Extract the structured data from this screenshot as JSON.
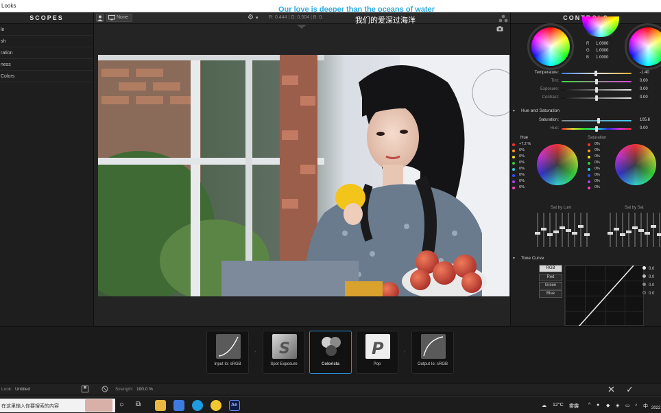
{
  "window": {
    "title": "Looks"
  },
  "subtitles": {
    "english": "Our love is deeper than the oceans of water",
    "chinese": "我们的爱深过海洋"
  },
  "scopes": {
    "header": "SCOPES",
    "items": [
      "le",
      "sh",
      "ration",
      "ness",
      "Colors"
    ]
  },
  "viewer": {
    "preset_label": "None",
    "readout": "R: 0.444 | G: 0.504 | B: 0.",
    "gear_menu": "▾"
  },
  "controls": {
    "header": "CONTROLS",
    "rgb_values": {
      "r_label": "R",
      "g_label": "G",
      "b_label": "B",
      "r": "1.0000",
      "g": "1.0000",
      "b": "1.0000"
    },
    "color_sliders": [
      {
        "label": "Temperature:",
        "value": "-1.40",
        "pos": 0.49
      },
      {
        "label": "Tint:",
        "value": "0.00",
        "pos": 0.5
      },
      {
        "label": "Exposure:",
        "value": "0.00",
        "pos": 0.5
      },
      {
        "label": "Contrast:",
        "value": "0.00",
        "pos": 0.5
      }
    ],
    "hue_sat": {
      "title": "Hue and Saturation",
      "sliders": [
        {
          "label": "Saturation:",
          "value": "105.6",
          "pos": 0.53
        },
        {
          "label": "Hue:",
          "value": "0.00",
          "pos": 0.5
        }
      ],
      "hue_label": "Hue",
      "sat_label": "Saturation",
      "hue_values": [
        "+7.2 %",
        "0%",
        "0%",
        "0%",
        "0%",
        "0%",
        "0%",
        "0%"
      ],
      "sat_values": [
        "0%",
        "0%",
        "0%",
        "0%",
        "0%",
        "0%",
        "0%",
        "0%"
      ],
      "dot_colors": [
        "#ff3030",
        "#ff9a20",
        "#f0e020",
        "#30d030",
        "#30d0d0",
        "#3050ff",
        "#b040f0",
        "#ff40c0"
      ]
    },
    "sat_by_lum": "Sat by Lum",
    "sat_by_sat": "Sat by Sat",
    "tone_curve": {
      "title": "Tone Curve",
      "channels": [
        "RGB",
        "Red",
        "Green",
        "Blue"
      ],
      "active": "RGB",
      "point_values": [
        "0.0",
        "0.0",
        "0.0",
        "0.0"
      ]
    }
  },
  "tools": [
    {
      "name": "Input Io: sRGB",
      "active": false
    },
    {
      "name": "Spot Exposure",
      "active": false
    },
    {
      "name": "Colorista",
      "active": true
    },
    {
      "name": "Pop",
      "active": false
    },
    {
      "name": "Output Io: sRGB",
      "active": false
    }
  ],
  "status": {
    "look_label": "Look:",
    "look_value": "Untitled",
    "strength_label": "Strength:",
    "strength_value": "100.0 %"
  },
  "taskbar": {
    "search_placeholder": "在这里输入你要搜索的内容",
    "weather": "12°C",
    "weather_desc": "雾霾",
    "ime": "中",
    "year_fragment": "2022"
  }
}
